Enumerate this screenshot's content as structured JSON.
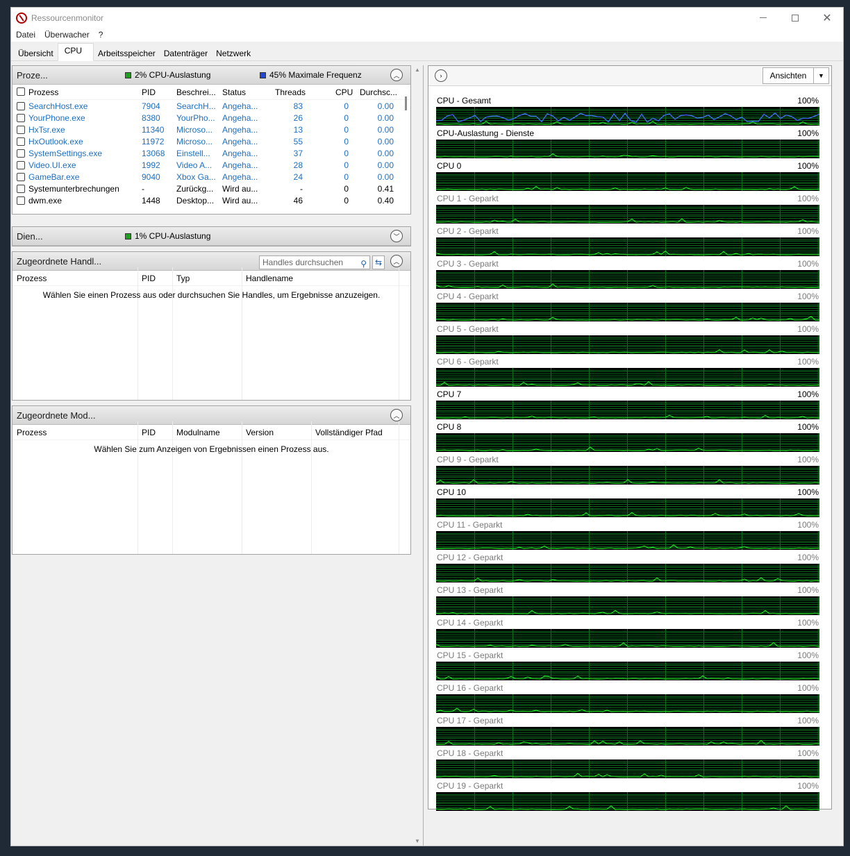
{
  "window": {
    "title": "Ressourcenmonitor"
  },
  "menu": [
    "Datei",
    "Überwacher",
    "?"
  ],
  "tabs": [
    "Übersicht",
    "CPU",
    "Arbeitsspeicher",
    "Datenträger",
    "Netzwerk"
  ],
  "processes": {
    "title": "Proze...",
    "cpu_usage": "2% CPU-Auslastung",
    "max_freq": "45% Maximale Frequenz",
    "columns": [
      "Prozess",
      "PID",
      "Beschrei...",
      "Status",
      "Threads",
      "CPU",
      "Durchsc..."
    ],
    "rows": [
      {
        "name": "SearchHost.exe",
        "pid": "7904",
        "desc": "SearchH...",
        "status": "Angeha...",
        "threads": "83",
        "cpu": "0",
        "avg": "0.00",
        "suspended": true
      },
      {
        "name": "YourPhone.exe",
        "pid": "8380",
        "desc": "YourPho...",
        "status": "Angeha...",
        "threads": "26",
        "cpu": "0",
        "avg": "0.00",
        "suspended": true
      },
      {
        "name": "HxTsr.exe",
        "pid": "11340",
        "desc": "Microso...",
        "status": "Angeha...",
        "threads": "13",
        "cpu": "0",
        "avg": "0.00",
        "suspended": true
      },
      {
        "name": "HxOutlook.exe",
        "pid": "11972",
        "desc": "Microso...",
        "status": "Angeha...",
        "threads": "55",
        "cpu": "0",
        "avg": "0.00",
        "suspended": true
      },
      {
        "name": "SystemSettings.exe",
        "pid": "13068",
        "desc": "Einstell...",
        "status": "Angeha...",
        "threads": "37",
        "cpu": "0",
        "avg": "0.00",
        "suspended": true
      },
      {
        "name": "Video.UI.exe",
        "pid": "1992",
        "desc": "Video A...",
        "status": "Angeha...",
        "threads": "28",
        "cpu": "0",
        "avg": "0.00",
        "suspended": true
      },
      {
        "name": "GameBar.exe",
        "pid": "9040",
        "desc": "Xbox Ga...",
        "status": "Angeha...",
        "threads": "24",
        "cpu": "0",
        "avg": "0.00",
        "suspended": true
      },
      {
        "name": "Systemunterbrechungen",
        "pid": "-",
        "desc": "Zurückg...",
        "status": "Wird au...",
        "threads": "-",
        "cpu": "0",
        "avg": "0.41",
        "suspended": false
      },
      {
        "name": "dwm.exe",
        "pid": "1448",
        "desc": "Desktop...",
        "status": "Wird au...",
        "threads": "46",
        "cpu": "0",
        "avg": "0.40",
        "suspended": false
      }
    ]
  },
  "services": {
    "title": "Dien...",
    "cpu_usage": "1% CPU-Auslastung"
  },
  "handles": {
    "title": "Zugeordnete Handl...",
    "search_placeholder": "Handles durchsuchen",
    "columns": [
      "Prozess",
      "PID",
      "Typ",
      "Handlename"
    ],
    "empty": "Wählen Sie einen Prozess aus oder durchsuchen Sie Handles, um Ergebnisse anzuzeigen."
  },
  "modules": {
    "title": "Zugeordnete Mod...",
    "columns": [
      "Prozess",
      "PID",
      "Modulname",
      "Version",
      "Vollständiger Pfad"
    ],
    "empty": "Wählen Sie zum Anzeigen von Ergebnissen einen Prozess aus."
  },
  "graphs": {
    "views_label": "Ansichten",
    "items": [
      {
        "label": "CPU - Gesamt",
        "max": "100%",
        "parked": false
      },
      {
        "label": "CPU-Auslastung - Dienste",
        "max": "100%",
        "parked": false
      },
      {
        "label": "CPU 0",
        "max": "100%",
        "parked": false
      },
      {
        "label": "CPU 1 - Geparkt",
        "max": "100%",
        "parked": true
      },
      {
        "label": "CPU 2 - Geparkt",
        "max": "100%",
        "parked": true
      },
      {
        "label": "CPU 3 - Geparkt",
        "max": "100%",
        "parked": true
      },
      {
        "label": "CPU 4 - Geparkt",
        "max": "100%",
        "parked": true
      },
      {
        "label": "CPU 5 - Geparkt",
        "max": "100%",
        "parked": true
      },
      {
        "label": "CPU 6 - Geparkt",
        "max": "100%",
        "parked": true
      },
      {
        "label": "CPU 7",
        "max": "100%",
        "parked": false
      },
      {
        "label": "CPU 8",
        "max": "100%",
        "parked": false
      },
      {
        "label": "CPU 9 - Geparkt",
        "max": "100%",
        "parked": true
      },
      {
        "label": "CPU 10",
        "max": "100%",
        "parked": false
      },
      {
        "label": "CPU 11 - Geparkt",
        "max": "100%",
        "parked": true
      },
      {
        "label": "CPU 12 - Geparkt",
        "max": "100%",
        "parked": true
      },
      {
        "label": "CPU 13 - Geparkt",
        "max": "100%",
        "parked": true
      },
      {
        "label": "CPU 14 - Geparkt",
        "max": "100%",
        "parked": true
      },
      {
        "label": "CPU 15 - Geparkt",
        "max": "100%",
        "parked": true
      },
      {
        "label": "CPU 16 - Geparkt",
        "max": "100%",
        "parked": true
      },
      {
        "label": "CPU 17 - Geparkt",
        "max": "100%",
        "parked": true
      },
      {
        "label": "CPU 18 - Geparkt",
        "max": "100%",
        "parked": true
      },
      {
        "label": "CPU 19 - Geparkt",
        "max": "100%",
        "parked": true
      }
    ]
  },
  "colors": {
    "graph_bg": "#000000",
    "grid": "#0b6b1c",
    "line_green": "#22dd22",
    "line_blue": "#3a6cf0",
    "link_blue": "#1c6fc4"
  }
}
